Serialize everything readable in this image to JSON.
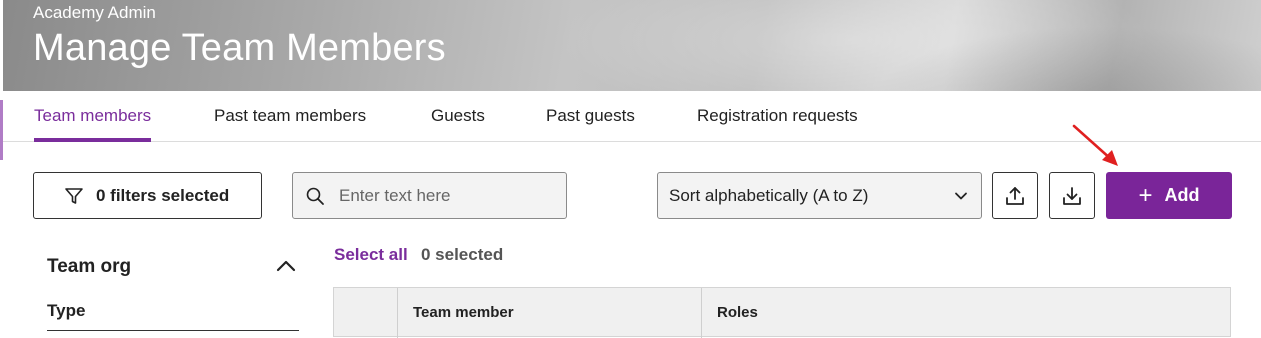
{
  "header": {
    "subtitle": "Academy Admin",
    "title": "Manage Team Members"
  },
  "tabs": [
    {
      "label": "Team members",
      "active": true
    },
    {
      "label": "Past team members",
      "active": false
    },
    {
      "label": "Guests",
      "active": false
    },
    {
      "label": "Past guests",
      "active": false
    },
    {
      "label": "Registration requests",
      "active": false
    }
  ],
  "toolbar": {
    "filter_label": "0 filters selected",
    "search_placeholder": "Enter text here",
    "sort_value": "Sort alphabetically (A to Z)",
    "upload_icon": "upload-icon",
    "download_icon": "download-icon",
    "add_label": "Add"
  },
  "filters": {
    "section_title": "Team org",
    "type_label": "Type"
  },
  "selection": {
    "select_all_label": "Select all",
    "selected_count": "0 selected"
  },
  "table": {
    "columns": [
      "",
      "Team member",
      "Roles"
    ]
  },
  "colors": {
    "accent": "#7a2599",
    "annotation_arrow": "#e02020"
  }
}
